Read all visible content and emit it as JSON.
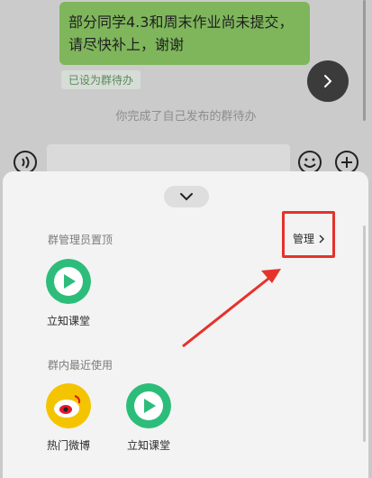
{
  "chat": {
    "message": "部分同学4.3和周末作业尚未提交，请尽快补上，谢谢",
    "tag": "已设为群待办",
    "system_note": "你完成了自己发布的群待办"
  },
  "sheet": {
    "pinned_title": "群管理员置顶",
    "manage_label": "管理",
    "recent_title": "群内最近使用",
    "pinned_apps": [
      {
        "label": "立知课堂",
        "icon": "lizhi-ketang-icon"
      }
    ],
    "recent_apps": [
      {
        "label": "热门微博",
        "icon": "weibo-icon"
      },
      {
        "label": "立知课堂",
        "icon": "lizhi-ketang-icon"
      }
    ]
  },
  "colors": {
    "bubble": "#7fb65c",
    "highlight": "#e5322b",
    "lizhi_green": "#2dbd7a",
    "weibo_yellow": "#f5c400"
  }
}
